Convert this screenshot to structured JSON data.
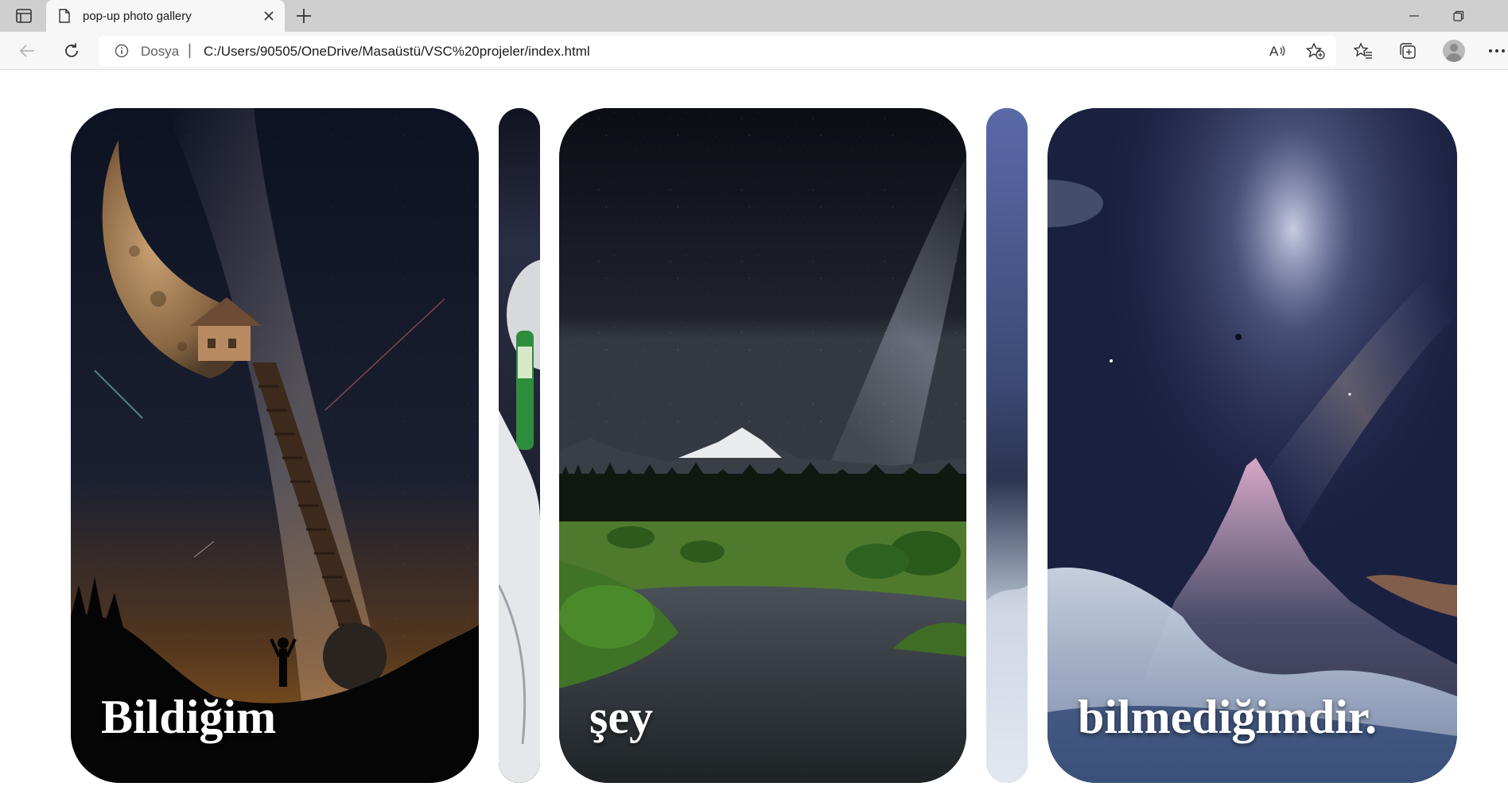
{
  "browser": {
    "tab_title": "pop-up photo gallery",
    "site_label": "Dosya",
    "url": "C:/Users/90505/OneDrive/Masaüstü/VSC%20projeler/index.html"
  },
  "gallery": {
    "panels": [
      {
        "caption": "Bildiğim"
      },
      {
        "caption": ""
      },
      {
        "caption": "şey"
      },
      {
        "caption": ""
      },
      {
        "caption": "bilmediğimdir."
      }
    ]
  },
  "colors": {
    "tabbar_bg": "#cfcfcf",
    "toolbar_bg": "#f7f7f7",
    "caption_text": "#ffffff"
  },
  "icons": {
    "sidebar": "sidebar-icon",
    "page": "page-icon",
    "close": "close-icon",
    "new_tab": "plus-icon",
    "back": "back-arrow-icon",
    "refresh": "refresh-icon",
    "info": "info-icon",
    "read_aloud": "read-aloud-icon",
    "add_favorite": "star-plus-icon",
    "favorites": "favorites-icon",
    "collections": "collections-icon",
    "profile": "avatar",
    "more": "more-icon"
  }
}
